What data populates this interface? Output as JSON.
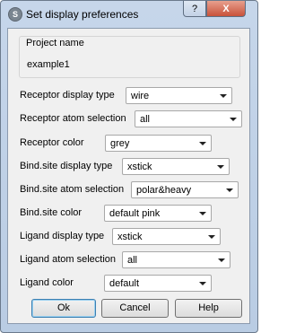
{
  "window": {
    "title": "Set display preferences",
    "help_label": "?",
    "close_label": "X"
  },
  "project": {
    "label": "Project name",
    "value": "example1"
  },
  "settings": [
    {
      "label": "Receptor display type",
      "value": "wire"
    },
    {
      "label": "Receptor atom selection",
      "value": "all"
    },
    {
      "label": "Receptor color",
      "value": "grey"
    },
    {
      "label": "Bind.site display type",
      "value": "xstick"
    },
    {
      "label": "Bind.site atom selection",
      "value": "polar&heavy"
    },
    {
      "label": "Bind.site color",
      "value": "default pink"
    },
    {
      "label": "Ligand display type",
      "value": "xstick"
    },
    {
      "label": "Ligand atom selection",
      "value": "all"
    },
    {
      "label": "Ligand color",
      "value": "default"
    }
  ],
  "buttons": {
    "ok": "Ok",
    "cancel": "Cancel",
    "help": "Help"
  }
}
